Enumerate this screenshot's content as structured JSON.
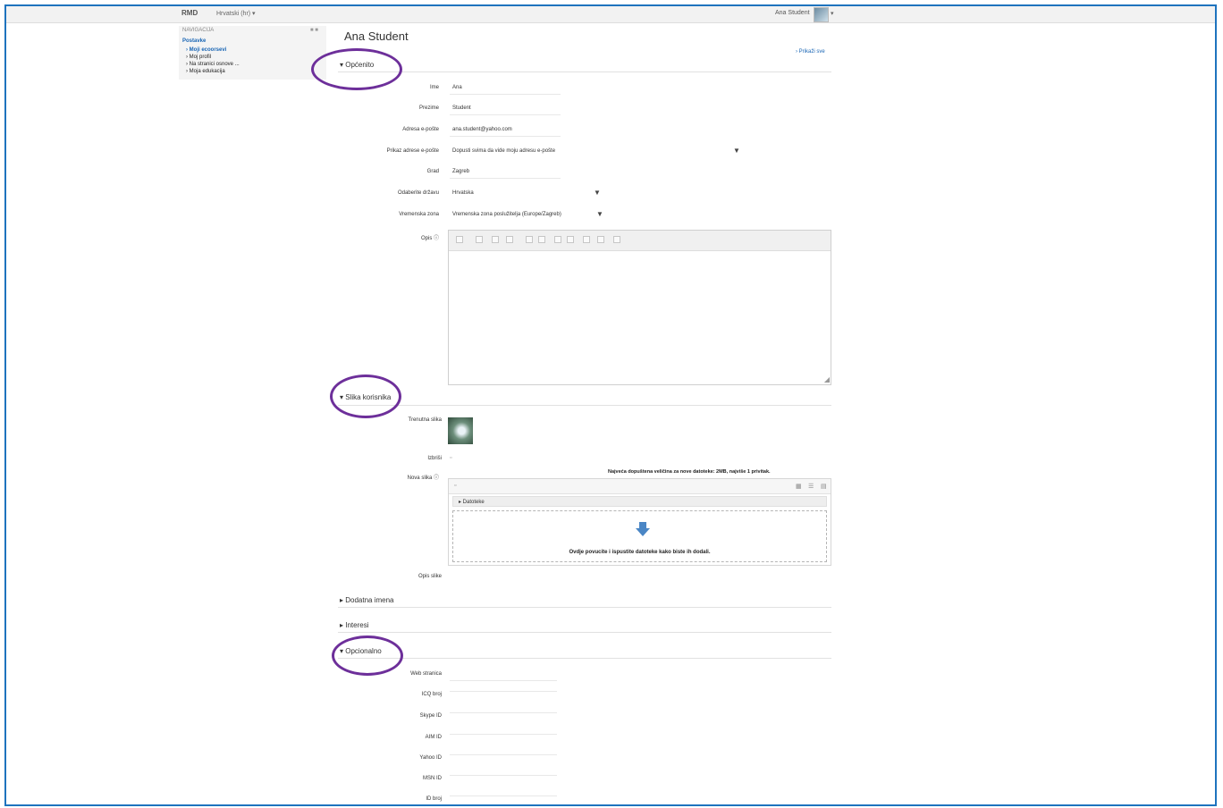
{
  "topbar": {
    "brand": "RMD",
    "language": "Hrvatski (hr) ▾",
    "user": "Ana Student",
    "caret": "▾"
  },
  "nav": {
    "header": "NAVIGACIJA",
    "edit": "■ ■",
    "items": [
      {
        "label": "Postavke",
        "link": true
      },
      {
        "label": "› Moji ecoorsevi",
        "link": true
      },
      {
        "label": "› Moj profil",
        "link": false
      },
      {
        "label": "› Na stranici osnove ...",
        "link": false
      },
      {
        "label": "› Moja edukacija",
        "link": false
      }
    ]
  },
  "page": {
    "title": "Ana Student",
    "collapse_all": "› Prikaži sve"
  },
  "sections": {
    "general": "▾ Općenito",
    "user_picture": "▾ Slika korisnika",
    "extra_names": "▸ Dodatna imena",
    "interests": "▸ Interesi",
    "optional": "▾ Opcionalno"
  },
  "general_fields": [
    {
      "label": "Ime",
      "value": "Ana"
    },
    {
      "label": "Prezime",
      "value": "Student"
    },
    {
      "label": "Adresa e-pošte",
      "value": "ana.student@yahoo.com"
    },
    {
      "label": "Prikaz adrese e-pošte",
      "value": "Dopusti svima da vide moju adresu e-pošte"
    },
    {
      "label": "Grad",
      "value": "Zagreb"
    },
    {
      "label": "Odaberite državu",
      "value": "Hrvatska"
    },
    {
      "label": "Vremenska zona",
      "value": "Vremenska zona poslužitelja (Europe/Zagreb)"
    },
    {
      "label": "Opis ⓘ",
      "value": ""
    }
  ],
  "picture_fields": {
    "current_label": "Trenutna slika",
    "delete_label": "Izbriši",
    "new_label": "Nova slika ⓘ",
    "filesize_note": "Najveća dopuštena veličina za nove datoteke: 2MB, najviše 1 privitak.",
    "folder_label": "▸ Datoteke",
    "drop_text": "Ovdje povucite i ispustite datoteke kako biste ih dodali.",
    "description_label": "Opis slike"
  },
  "optional_fields": [
    {
      "label": "Web stranica"
    },
    {
      "label": "ICQ broj"
    },
    {
      "label": "Skype ID"
    },
    {
      "label": "AIM ID"
    },
    {
      "label": "Yahoo ID"
    },
    {
      "label": "MSN ID"
    },
    {
      "label": "ID broj"
    }
  ],
  "colors": {
    "frame": "#1e73be",
    "highlight_circle": "#6d2f9a",
    "link": "#1a66b5"
  }
}
